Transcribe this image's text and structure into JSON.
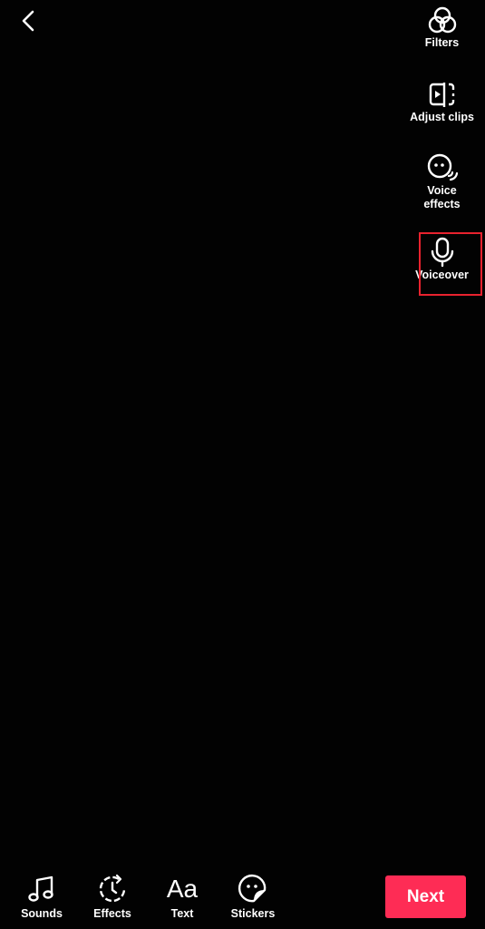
{
  "screen": {
    "name": "video-edit",
    "background": "#000000"
  },
  "nav": {
    "back_icon": "chevron-left-icon"
  },
  "side_tools": [
    {
      "id": "filters",
      "label": "Filters",
      "icon": "filters-icon"
    },
    {
      "id": "adjust-clips",
      "label": "Adjust clips",
      "icon": "adjust-clips-icon"
    },
    {
      "id": "voice-effects",
      "label_line1": "Voice",
      "label_line2": "effects",
      "icon": "voice-effects-icon"
    },
    {
      "id": "voiceover",
      "label": "Voiceover",
      "icon": "microphone-icon",
      "highlighted": true
    }
  ],
  "bottom_tools": [
    {
      "id": "sounds",
      "label": "Sounds",
      "icon": "music-note-icon"
    },
    {
      "id": "effects",
      "label": "Effects",
      "icon": "effects-timer-icon"
    },
    {
      "id": "text",
      "label": "Text",
      "icon_text": "Aa",
      "icon": "text-icon"
    },
    {
      "id": "stickers",
      "label": "Stickers",
      "icon": "sticker-icon"
    }
  ],
  "next_button": {
    "label": "Next",
    "color": "#fe2c55"
  },
  "highlight": {
    "target": "voiceover",
    "color": "#e8222e"
  }
}
